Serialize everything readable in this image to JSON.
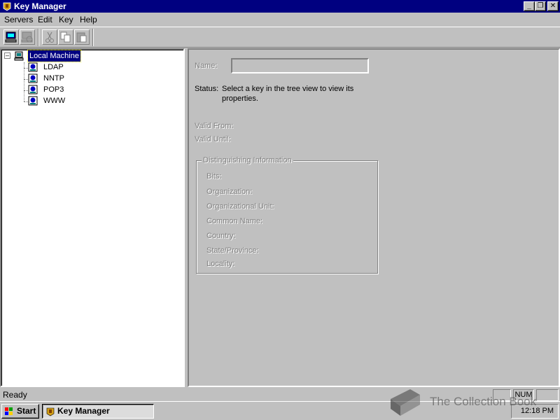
{
  "window": {
    "title": "Key Manager",
    "controls": [
      "minimize",
      "restore",
      "close"
    ]
  },
  "menu": {
    "items": [
      {
        "label": "Servers",
        "mnemonic": "S"
      },
      {
        "label": "Edit",
        "mnemonic": "E"
      },
      {
        "label": "Key",
        "mnemonic": "K"
      },
      {
        "label": "Help",
        "mnemonic": "H"
      }
    ]
  },
  "toolbar": {
    "buttons": [
      {
        "icon": "connect-computer-icon"
      },
      {
        "icon": "disconnect-computer-icon"
      },
      {
        "icon": "cut-icon"
      },
      {
        "icon": "copy-icon"
      },
      {
        "icon": "paste-icon"
      }
    ]
  },
  "tree": {
    "root": {
      "label": "Local Machine",
      "expanded": true,
      "selected": true,
      "icon": "computer-icon"
    },
    "children": [
      {
        "label": "LDAP",
        "icon": "server-icon"
      },
      {
        "label": "NNTP",
        "icon": "server-icon"
      },
      {
        "label": "POP3",
        "icon": "server-icon"
      },
      {
        "label": "WWW",
        "icon": "server-icon"
      }
    ]
  },
  "details": {
    "name_label": "Name:",
    "name_value": "",
    "status_label": "Status:",
    "status_text": "Select a key in the tree view to view its properties.",
    "valid_from_label": "Valid From:",
    "valid_until_label": "Valid Until:",
    "group": {
      "title": "Distinguishing Information",
      "fields": [
        "Bits:",
        "Organization:",
        "Organizational Unit:",
        "Common Name:",
        "Country:",
        "State/Province:",
        "Locality:"
      ]
    }
  },
  "statusbar": {
    "text": "Ready",
    "panes": [
      "",
      "NUM",
      ""
    ]
  },
  "taskbar": {
    "start_label": "Start",
    "task_label": "Key Manager",
    "clock": "12:18 PM"
  },
  "watermark": {
    "text": "The Collection Book"
  },
  "colors": {
    "titlebar": "#000080",
    "face": "#c0c0c0",
    "selection": "#000080",
    "disabled_text": "#808080"
  }
}
